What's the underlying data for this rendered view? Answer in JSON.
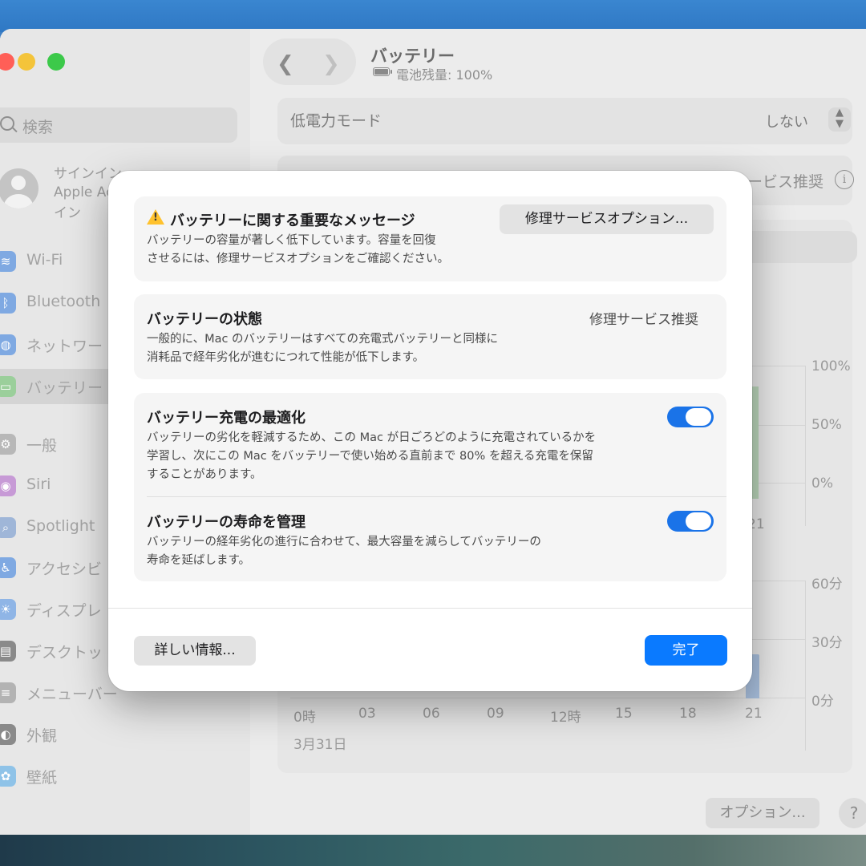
{
  "window": {
    "title": "バッテリー",
    "battery_level": "電池残量: 100%",
    "traffic_lights": [
      "#f4c43a",
      "#3cc94a"
    ]
  },
  "sidebar": {
    "search_placeholder": "検索",
    "signin": [
      "サインイン",
      "Apple Ac",
      "イン"
    ],
    "items": [
      {
        "label": "Wi-Fi",
        "icon": "wifi-icon",
        "color": "#7fa9e2"
      },
      {
        "label": "Bluetooth",
        "icon": "bluetooth-icon",
        "color": "#7fa9e2"
      },
      {
        "label": "ネットワー",
        "icon": "globe-icon",
        "color": "#7fa9e2"
      },
      {
        "label": "バッテリー",
        "icon": "battery-icon",
        "color": "#9bcf9b",
        "selected": true
      },
      {
        "label": "一般",
        "icon": "gear-icon",
        "color": "#b8b8b8"
      },
      {
        "label": "Siri",
        "icon": "siri-icon",
        "color": "#c79ad6"
      },
      {
        "label": "Spotlight",
        "icon": "magnifier-icon",
        "color": "#9fb6d8"
      },
      {
        "label": "アクセシビ",
        "icon": "accessibility-icon",
        "color": "#7fa9e2"
      },
      {
        "label": "ディスプレ",
        "icon": "sun-icon",
        "color": "#8fb5e6"
      },
      {
        "label": "デスクトッ",
        "icon": "desktop-icon",
        "color": "#8a8a8a"
      },
      {
        "label": "メニューバー",
        "icon": "menubar-icon",
        "color": "#b3b3b3"
      },
      {
        "label": "外観",
        "icon": "appearance-icon",
        "color": "#8a8a8a"
      },
      {
        "label": "壁紙",
        "icon": "wallpaper-icon",
        "color": "#8fc3e8"
      }
    ]
  },
  "background": {
    "low_power_label": "低電力モード",
    "low_power_value": "しない",
    "health_fragment": "ービス推奨",
    "level_axis": [
      "100%",
      "50%",
      "0%"
    ],
    "usage_axis": [
      "60分",
      "30分",
      "0分"
    ],
    "time_labels": [
      "0時",
      "03",
      "06",
      "09",
      "12時",
      "15",
      "18",
      "21"
    ],
    "level_time_fragment": "21",
    "date_label": "3月31日",
    "options_button": "オプション...",
    "help_button": "?"
  },
  "dialog": {
    "message": {
      "title": "バッテリーに関する重要なメッセージ",
      "desc_lines": [
        "バッテリーの容量が著しく低下しています。容量を回復",
        "させるには、修理サービスオプションをご確認ください。"
      ],
      "repair_button": "修理サービスオプション..."
    },
    "status": {
      "title": "バッテリーの状態",
      "value": "修理サービス推奨",
      "desc_lines": [
        "一般的に、Mac のバッテリーはすべての充電式バッテリーと同様に",
        "消耗品で経年劣化が進むにつれて性能が低下します。"
      ]
    },
    "optimized": {
      "title": "バッテリー充電の最適化",
      "desc_lines": [
        "バッテリーの劣化を軽減するため、この Mac が日ごろどのように充電されているかを",
        "学習し、次にこの Mac をバッテリーで使い始める直前まで 80% を超える充電を保留",
        "することがあります。"
      ],
      "enabled": true
    },
    "lifespan": {
      "title": "バッテリーの寿命を管理",
      "desc_lines": [
        "バッテリーの経年劣化の進行に合わせて、最大容量を減らしてバッテリーの",
        "寿命を延ばします。"
      ],
      "enabled": true
    },
    "detail_button": "詳しい情報...",
    "done_button": "完了",
    "accent": "#0a7aff"
  }
}
